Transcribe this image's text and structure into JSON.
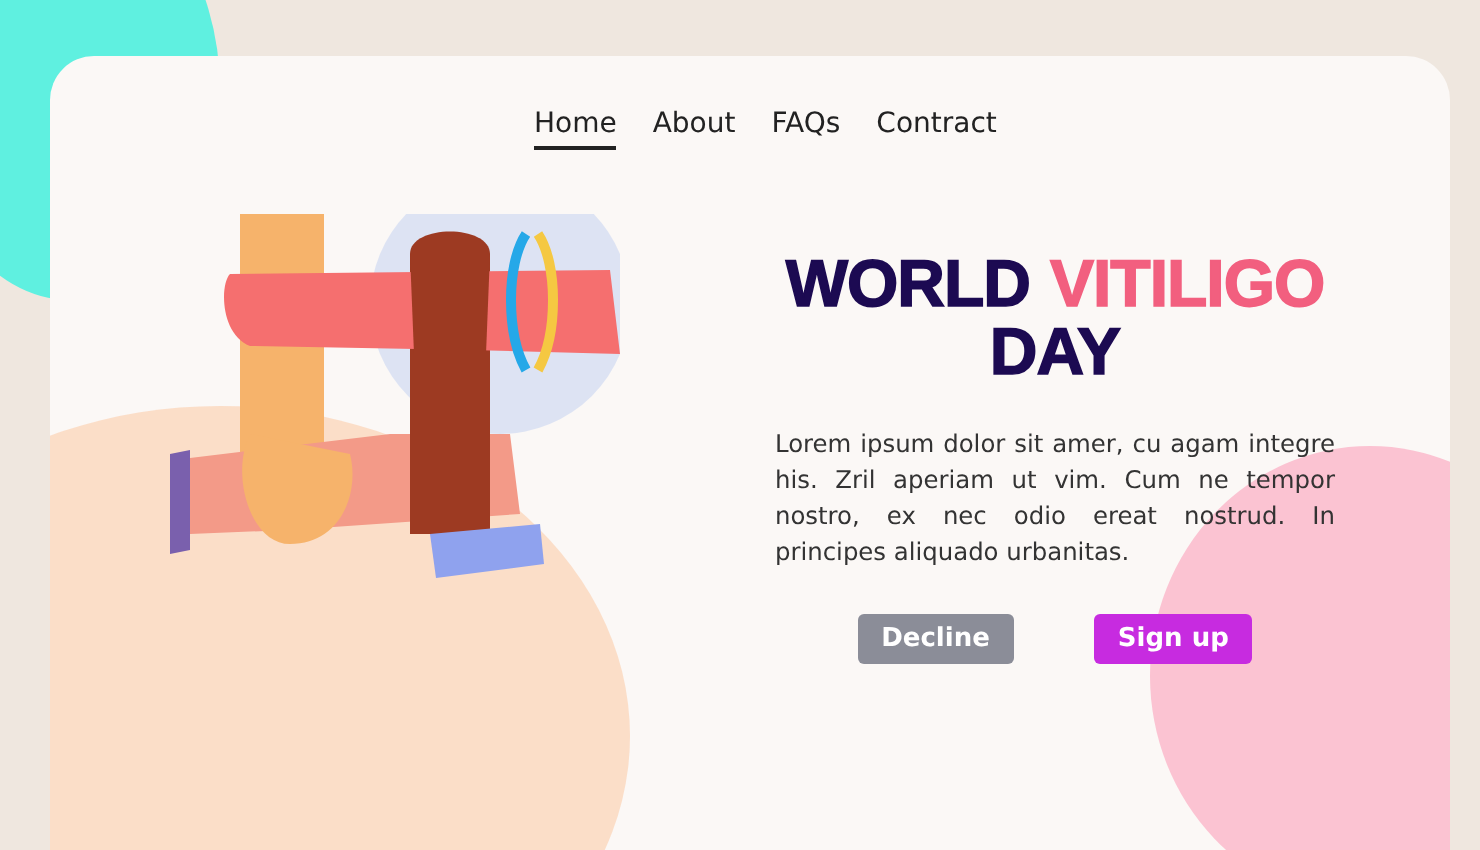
{
  "nav": [
    {
      "label": "Home",
      "selected": true
    },
    {
      "label": "About",
      "selected": false
    },
    {
      "label": "FAQs",
      "selected": false
    },
    {
      "label": "Contract",
      "selected": false
    }
  ],
  "headline": {
    "lines": [
      [
        {
          "text": "WORLD",
          "color": "#1c0a52"
        },
        {
          "text": "VITILIGO",
          "color": "#f25f7f"
        }
      ],
      [
        {
          "text": "DAY",
          "color": "#1c0a52"
        }
      ]
    ]
  },
  "body": "Lorem ipsum dolor sit amer, cu  agam  integre  his. Zril aperiam ut vim. Cum ne tempor nostro, ex nec odio ereat nostrud. In principes aliquado urbanitas.",
  "buttons": [
    {
      "label": "Decline",
      "kind": "secondary"
    },
    {
      "label": "Sign up",
      "kind": "primary"
    }
  ]
}
